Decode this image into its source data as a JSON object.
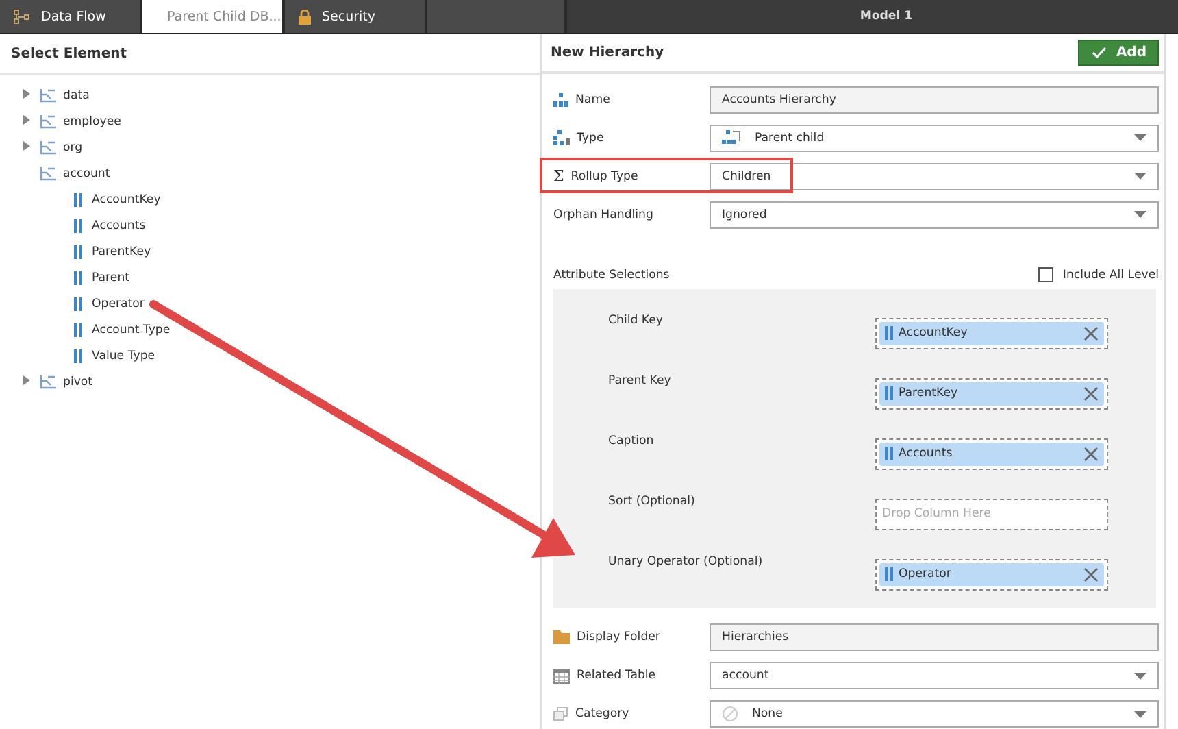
{
  "tabs": [
    {
      "label": "Data Flow",
      "selected": false
    },
    {
      "label": "Parent Child DB...",
      "selected": true
    },
    {
      "label": "Security",
      "selected": false
    }
  ],
  "window": {
    "title": "Model 1"
  },
  "left_panel": {
    "title": "Select Element",
    "tree": [
      {
        "label": "data",
        "expanded": false
      },
      {
        "label": "employee",
        "expanded": false
      },
      {
        "label": "org",
        "expanded": false
      },
      {
        "label": "account",
        "expanded": true,
        "children": [
          {
            "label": "AccountKey"
          },
          {
            "label": "Accounts"
          },
          {
            "label": "ParentKey"
          },
          {
            "label": "Parent"
          },
          {
            "label": "Operator"
          },
          {
            "label": "Account Type"
          },
          {
            "label": "Value Type"
          }
        ]
      },
      {
        "label": "pivot",
        "expanded": false
      }
    ]
  },
  "right_panel": {
    "title": "New Hierarchy",
    "add_button": "Add",
    "fields": [
      {
        "label": "Name",
        "kind": "text",
        "value": "Accounts Hierarchy"
      },
      {
        "label": "Type",
        "kind": "select",
        "value": "Parent child"
      },
      {
        "label": "Rollup Type",
        "symbol": "Σ",
        "kind": "select",
        "value": "Children"
      },
      {
        "label": "Orphan Handling",
        "kind": "select",
        "value": "Ignored"
      }
    ],
    "attribute_selections": {
      "title": "Attribute Selections",
      "include_all_levels": {
        "label": "Include All Level",
        "checked": false
      },
      "slots": [
        {
          "label": "Child Key",
          "value": "AccountKey"
        },
        {
          "label": "Parent Key",
          "value": "ParentKey"
        },
        {
          "label": "Caption",
          "value": "Accounts"
        },
        {
          "label": "Sort (Optional)",
          "placeholder": "Drop Column Here"
        },
        {
          "label": "Unary Operator (Optional)",
          "value": "Operator"
        }
      ]
    },
    "bottom_fields": [
      {
        "label": "Display Folder",
        "kind": "text",
        "value": "Hierarchies"
      },
      {
        "label": "Related Table",
        "kind": "select",
        "value": "account"
      },
      {
        "label": "Category",
        "kind": "select",
        "value": "None"
      }
    ]
  }
}
